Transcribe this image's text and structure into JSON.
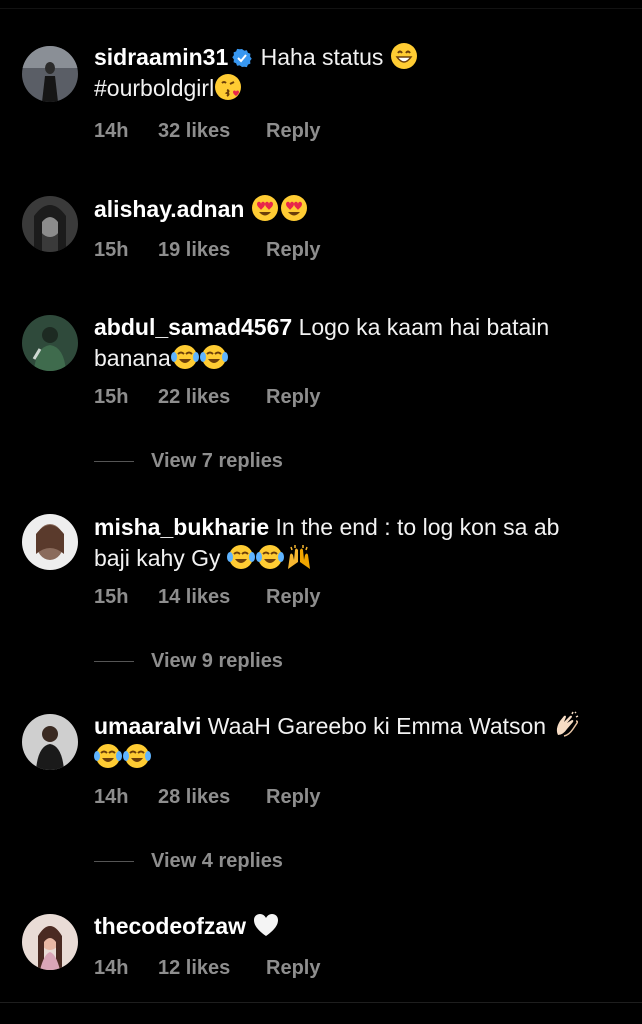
{
  "comments": [
    {
      "username": "sidraamin31",
      "verified": true,
      "text": "Haha status",
      "text2": "#ourboldgirl",
      "time": "14h",
      "likes": "32 likes",
      "reply": "Reply"
    },
    {
      "username": "alishay.adnan",
      "text": "",
      "time": "15h",
      "likes": "19 likes",
      "reply": "Reply"
    },
    {
      "username": "abdul_samad4567",
      "text": "Logo ka kaam hai batain",
      "text2": "banana",
      "time": "15h",
      "likes": "22 likes",
      "reply": "Reply",
      "view_replies": "View 7 replies"
    },
    {
      "username": "misha_bukharie",
      "text": "In the end : to log kon sa ab",
      "text2": "baji kahy Gy",
      "time": "15h",
      "likes": "14 likes",
      "reply": "Reply",
      "view_replies": "View 9 replies"
    },
    {
      "username": "umaaralvi",
      "text": "WaaH Gareebo ki Emma Watson",
      "time": "14h",
      "likes": "28 likes",
      "reply": "Reply",
      "view_replies": "View 4 replies"
    },
    {
      "username": "thecodeofzaw",
      "text": "",
      "time": "14h",
      "likes": "12 likes",
      "reply": "Reply"
    }
  ],
  "icons": {
    "verified": "verified-badge-icon",
    "grin": "grinning-face-emoji",
    "kiss": "face-blowing-kiss-emoji",
    "heart_eyes": "heart-eyes-emoji",
    "joy": "tears-of-joy-emoji",
    "raised_hands": "raised-hands-emoji",
    "clap": "clapping-hands-emoji",
    "white_heart": "white-heart-emoji"
  },
  "colors": {
    "background": "#000000",
    "text": "#ffffff",
    "muted": "#8e8e8e",
    "verified": "#3897f0"
  }
}
